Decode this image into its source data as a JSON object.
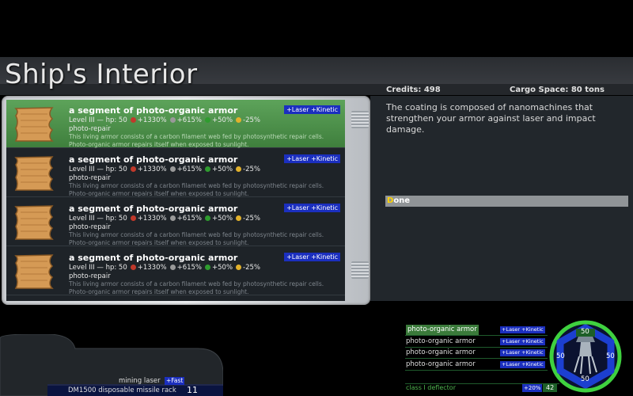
{
  "header": {
    "title": "Ship's Interior",
    "credits": "Credits: 498",
    "cargo": "Cargo Space: 80 tons"
  },
  "list": {
    "items": [
      {
        "name": "a segment of photo-organic armor",
        "badge": "+Laser +Kinetic",
        "level_hp": "Level III — hp: 50",
        "stat1": "+1330%",
        "stat2": "+615%",
        "stat3": "+50%",
        "stat4": "-25%",
        "ability": "photo-repair",
        "desc": "This living armor consists of a carbon filament web fed by photosynthetic repair cells. Photo-organic armor repairs itself when exposed to sunlight.",
        "selected": true
      },
      {
        "name": "a segment of photo-organic armor",
        "badge": "+Laser +Kinetic",
        "level_hp": "Level III — hp: 50",
        "stat1": "+1330%",
        "stat2": "+615%",
        "stat3": "+50%",
        "stat4": "-25%",
        "ability": "photo-repair",
        "desc": "This living armor consists of a carbon filament web fed by photosynthetic repair cells. Photo-organic armor repairs itself when exposed to sunlight.",
        "selected": false
      },
      {
        "name": "a segment of photo-organic armor",
        "badge": "+Laser +Kinetic",
        "level_hp": "Level III — hp: 50",
        "stat1": "+1330%",
        "stat2": "+615%",
        "stat3": "+50%",
        "stat4": "-25%",
        "ability": "photo-repair",
        "desc": "This living armor consists of a carbon filament web fed by photosynthetic repair cells. Photo-organic armor repairs itself when exposed to sunlight.",
        "selected": false
      },
      {
        "name": "a segment of photo-organic armor",
        "badge": "+Laser +Kinetic",
        "level_hp": "Level III — hp: 50",
        "stat1": "+1330%",
        "stat2": "+615%",
        "stat3": "+50%",
        "stat4": "-25%",
        "ability": "photo-repair",
        "desc": "This living armor consists of a carbon filament web fed by photosynthetic repair cells. Photo-organic armor repairs itself when exposed to sunlight.",
        "selected": false
      }
    ]
  },
  "details": {
    "description": "The coating is composed of nanomachines that strengthen your armor against laser and impact damage.",
    "done_first": "D",
    "done_rest": "one"
  },
  "weapons": {
    "primary": "mining laser",
    "primary_badge": "+Fast",
    "secondary": "DM1500 disposable missile rack",
    "secondary_ammo": "11"
  },
  "armor_status": {
    "segments": [
      {
        "name": "photo-organic armor",
        "badge": "+Laser +Kinetic"
      },
      {
        "name": "photo-organic armor",
        "badge": "+Laser +Kinetic"
      },
      {
        "name": "photo-organic armor",
        "badge": "+Laser +Kinetic"
      },
      {
        "name": "photo-organic armor",
        "badge": "+Laser +Kinetic"
      }
    ],
    "shield_name": "class I deflector",
    "shield_badge": "+20%",
    "shield_value": "42",
    "hp_top": "50",
    "hp_left": "50",
    "hp_right": "50",
    "hp_bottom": "50"
  },
  "colors": {
    "selected_row": "#4f924c",
    "badge_blue": "#1b2fbf",
    "shield_green": "#3fd13f",
    "armor_blue": "#1c3fd0"
  }
}
